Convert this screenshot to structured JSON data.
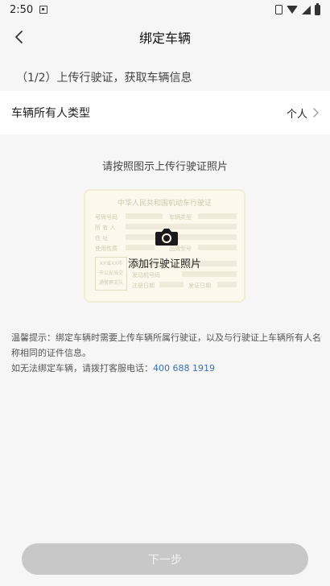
{
  "status_bar": {
    "time": "2:50",
    "notification_icon": "notification-icon",
    "icons": [
      "vibrate-icon",
      "wifi-icon",
      "signal-icon",
      "battery-icon"
    ]
  },
  "nav": {
    "back_icon": "chevron-left-icon",
    "title": "绑定车辆"
  },
  "step_text": "（1/2）上传行驶证，获取车辆信息",
  "owner_type": {
    "label": "车辆所有人类型",
    "value": "个人",
    "chevron_icon": "chevron-right-icon"
  },
  "upload": {
    "hint": "请按照图示上传行驶证照片",
    "card_title": "中华人民共和国机动车行驶证",
    "card_fields": [
      "号牌号码",
      "车辆类型",
      "所 有 人",
      "住  址",
      "使用性质",
      "品牌型号",
      "车辆识别代号",
      "发动机号码",
      "注册日期",
      "发证日期"
    ],
    "stamp_text": [
      "XX省XX市",
      "市公安局交",
      "通警察支队"
    ],
    "camera_icon": "camera-icon",
    "caption": "添加行驶证照片"
  },
  "tips": {
    "line1": "温馨提示：绑定车辆时需要上传车辆所属行驶证，以及与行驶证上车辆所有人名称相同的证件信息。",
    "line2_prefix": "如无法绑定车辆，请拨打客服电话：",
    "phone": "400 688 1919"
  },
  "next_button": "下一步",
  "colors": {
    "background": "#f6f6f7",
    "card_bg": "#fcf9ec",
    "link": "#3b6fb6",
    "button_disabled": "#c8c8c9"
  }
}
